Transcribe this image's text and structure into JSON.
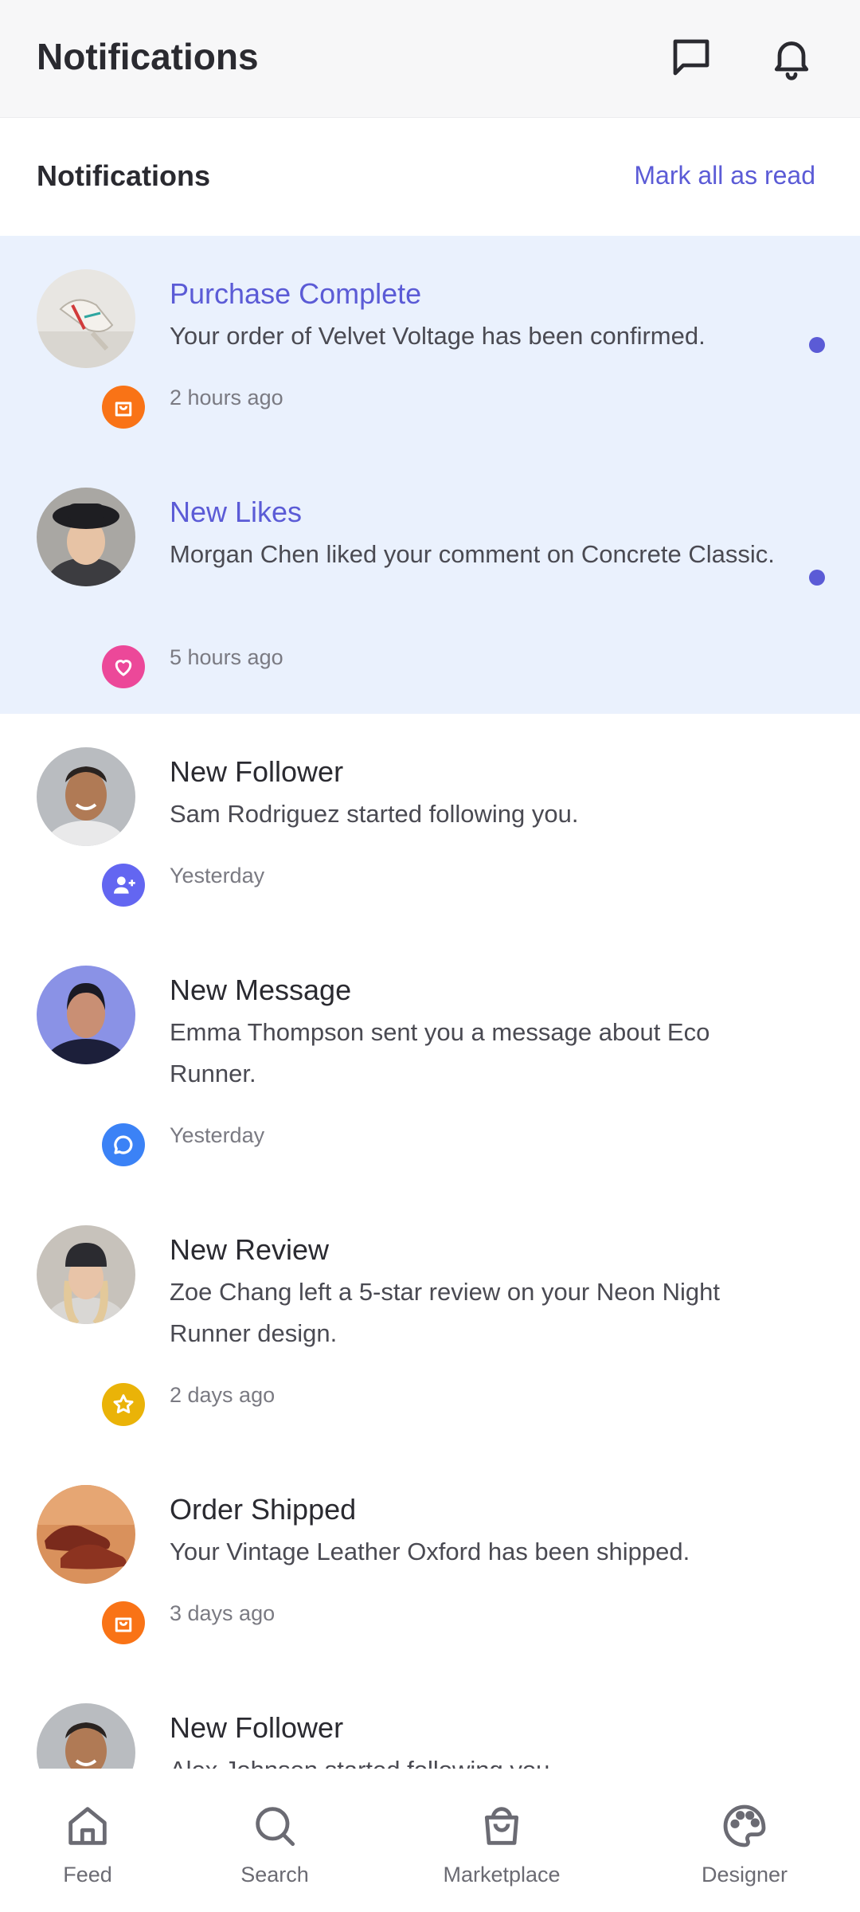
{
  "header": {
    "title": "Notifications",
    "messages_icon": "chat-bubble-icon",
    "bell_icon": "bell-icon"
  },
  "subheader": {
    "title": "Notifications",
    "mark_all_label": "Mark all as read"
  },
  "colors": {
    "accent": "#5b5bd6",
    "unread_background": "#eaf1fd",
    "badge_orange": "#f97316",
    "badge_pink": "#ec4899",
    "badge_purple": "#6366f1",
    "badge_blue": "#3b82f6",
    "badge_yellow": "#eab308"
  },
  "notifications": [
    {
      "title": "Purchase Complete",
      "body": "Your order of Velvet Voltage has been confirmed.",
      "time": "2 hours ago",
      "unread": true,
      "badge_icon": "shopping-bag-icon",
      "avatar": "sneaker-product-photo"
    },
    {
      "title": "New Likes",
      "body": "Morgan Chen liked your comment on Concrete Classic.",
      "time": "5 hours ago",
      "unread": true,
      "badge_icon": "heart-icon",
      "avatar": "person-with-hat-photo"
    },
    {
      "title": "New Follower",
      "body": "Sam Rodriguez started following you.",
      "time": "Yesterday",
      "unread": false,
      "badge_icon": "user-plus-icon",
      "avatar": "smiling-man-photo"
    },
    {
      "title": "New Message",
      "body": "Emma Thompson sent you a message about Eco Runner.",
      "time": "Yesterday",
      "unread": false,
      "badge_icon": "chat-icon",
      "avatar": "woman-blue-light-photo"
    },
    {
      "title": "New Review",
      "body": "Zoe Chang left a 5-star review on your Neon Night Runner design.",
      "time": "2 days ago",
      "unread": false,
      "badge_icon": "star-icon",
      "avatar": "woman-beanie-photo"
    },
    {
      "title": "Order Shipped",
      "body": "Your Vintage Leather Oxford has been shipped.",
      "time": "3 days ago",
      "unread": false,
      "badge_icon": "shopping-bag-icon",
      "avatar": "leather-shoes-photo"
    },
    {
      "title": "New Follower",
      "body": "Alex Johnson started following you.",
      "time": "",
      "unread": false,
      "badge_icon": "user-plus-icon",
      "avatar": "smiling-man-photo"
    }
  ],
  "bottom_nav": [
    {
      "label": "Feed",
      "icon": "home-icon"
    },
    {
      "label": "Search",
      "icon": "search-icon"
    },
    {
      "label": "Marketplace",
      "icon": "shopping-bag-icon"
    },
    {
      "label": "Designer",
      "icon": "palette-icon"
    }
  ]
}
